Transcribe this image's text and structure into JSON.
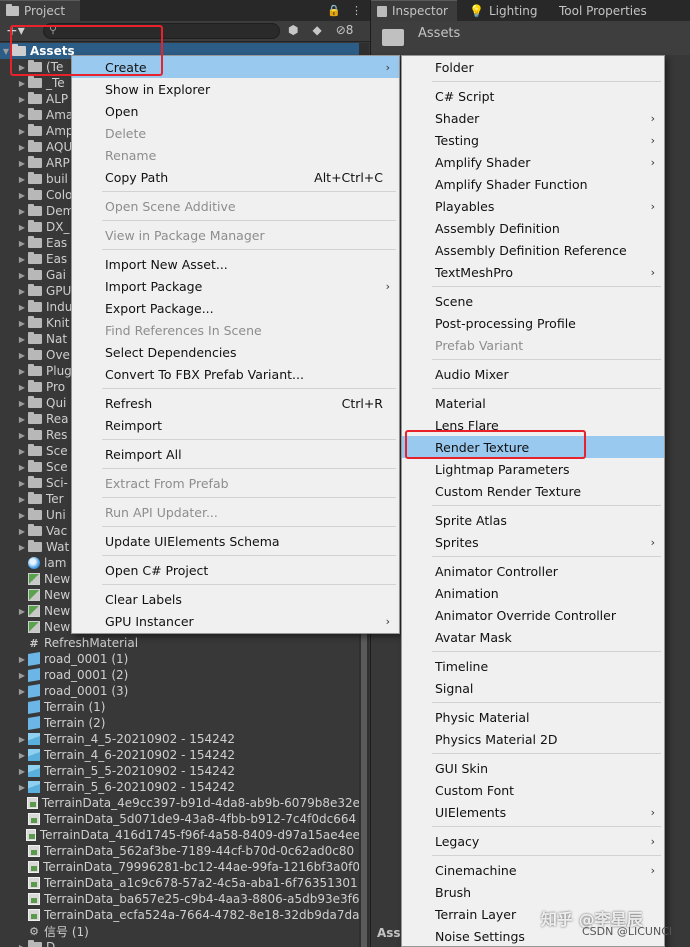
{
  "project_panel": {
    "tab_label": "Project",
    "hidden_count": "8",
    "assets_label": "Assets",
    "items": [
      {
        "label": "(Te",
        "type": "folder"
      },
      {
        "label": "_Te",
        "type": "folder"
      },
      {
        "label": "ALP",
        "type": "folder"
      },
      {
        "label": "Ama",
        "type": "folder"
      },
      {
        "label": "Amp",
        "type": "folder"
      },
      {
        "label": "AQU",
        "type": "folder"
      },
      {
        "label": "ARP",
        "type": "folder"
      },
      {
        "label": "buil",
        "type": "folder"
      },
      {
        "label": "Colo",
        "type": "folder"
      },
      {
        "label": "Dem",
        "type": "folder"
      },
      {
        "label": "DX_",
        "type": "folder"
      },
      {
        "label": "Eas",
        "type": "folder"
      },
      {
        "label": "Eas",
        "type": "folder"
      },
      {
        "label": "Gai",
        "type": "folder"
      },
      {
        "label": "GPU",
        "type": "folder"
      },
      {
        "label": "Indu",
        "type": "folder"
      },
      {
        "label": "Knit",
        "type": "folder"
      },
      {
        "label": "Nat",
        "type": "folder"
      },
      {
        "label": "Ove",
        "type": "folder"
      },
      {
        "label": "Plug",
        "type": "folder"
      },
      {
        "label": "Pro",
        "type": "folder"
      },
      {
        "label": "Qui",
        "type": "folder"
      },
      {
        "label": "Rea",
        "type": "folder"
      },
      {
        "label": "Res",
        "type": "folder"
      },
      {
        "label": "Sce",
        "type": "folder"
      },
      {
        "label": "Sce",
        "type": "folder"
      },
      {
        "label": "Sci-",
        "type": "folder"
      },
      {
        "label": "Ter",
        "type": "folder"
      },
      {
        "label": "Uni",
        "type": "folder"
      },
      {
        "label": "Vac",
        "type": "folder"
      },
      {
        "label": "Wat",
        "type": "folder"
      },
      {
        "label": "lam",
        "type": "sphere"
      },
      {
        "label": "New",
        "type": "rt"
      },
      {
        "label": "New",
        "type": "rt"
      },
      {
        "label": "New",
        "type": "rt",
        "arrow": true
      },
      {
        "label": "New",
        "type": "rt"
      },
      {
        "label": "RefreshMaterial",
        "type": "cs"
      },
      {
        "label": "road_0001 (1)",
        "type": "cube",
        "arrow": true
      },
      {
        "label": "road_0001 (2)",
        "type": "cube",
        "arrow": true
      },
      {
        "label": "road_0001 (3)",
        "type": "cube",
        "arrow": true
      },
      {
        "label": "Terrain (1)",
        "type": "cube"
      },
      {
        "label": "Terrain (2)",
        "type": "cube"
      },
      {
        "label": "Terrain_4_5-20210902 - 154242",
        "type": "terrain",
        "arrow": true
      },
      {
        "label": "Terrain_4_6-20210902 - 154242",
        "type": "terrain",
        "arrow": true
      },
      {
        "label": "Terrain_5_5-20210902 - 154242",
        "type": "terrain",
        "arrow": true
      },
      {
        "label": "Terrain_5_6-20210902 - 154242",
        "type": "terrain",
        "arrow": true
      },
      {
        "label": "TerrainData_4e9cc397-b91d-4da8-ab9b-6079b8e32e",
        "type": "tdata"
      },
      {
        "label": "TerrainData_5d071de9-43a8-4fbb-b912-7c4f0dc664",
        "type": "tdata"
      },
      {
        "label": "TerrainData_416d1745-f96f-4a58-8409-d97a15ae4ee",
        "type": "tdata"
      },
      {
        "label": "TerrainData_562af3be-7189-44cf-b70d-0c62ad0c80",
        "type": "tdata"
      },
      {
        "label": "TerrainData_79996281-bc12-44ae-99fa-1216bf3a0f0",
        "type": "tdata"
      },
      {
        "label": "TerrainData_a1c9c678-57a2-4c5a-aba1-6f76351301",
        "type": "tdata"
      },
      {
        "label": "TerrainData_ba657e25-c9b4-4aa3-8806-a5db93e3f6",
        "type": "tdata"
      },
      {
        "label": "TerrainData_ecfa524a-7664-4782-8e18-32db9da7da",
        "type": "tdata"
      },
      {
        "label": "信号 (1)",
        "type": "cfg"
      },
      {
        "label": "D...",
        "type": "folder"
      }
    ]
  },
  "inspector": {
    "tabs": [
      "Inspector",
      "Lighting",
      "Tool Properties"
    ],
    "header_title": "Assets",
    "bottom_label": "Ass"
  },
  "context_menu": {
    "items": [
      {
        "label": "Create",
        "submenu": true,
        "highlight": true
      },
      {
        "label": "Show in Explorer"
      },
      {
        "label": "Open"
      },
      {
        "label": "Delete",
        "disabled": true
      },
      {
        "label": "Rename",
        "disabled": true
      },
      {
        "label": "Copy Path",
        "shortcut": "Alt+Ctrl+C"
      },
      {
        "sep": true
      },
      {
        "label": "Open Scene Additive",
        "disabled": true
      },
      {
        "sep": true
      },
      {
        "label": "View in Package Manager",
        "disabled": true
      },
      {
        "sep": true
      },
      {
        "label": "Import New Asset..."
      },
      {
        "label": "Import Package",
        "submenu": true
      },
      {
        "label": "Export Package..."
      },
      {
        "label": "Find References In Scene",
        "disabled": true
      },
      {
        "label": "Select Dependencies"
      },
      {
        "label": "Convert To FBX Prefab Variant..."
      },
      {
        "sep": true
      },
      {
        "label": "Refresh",
        "shortcut": "Ctrl+R"
      },
      {
        "label": "Reimport"
      },
      {
        "sep": true
      },
      {
        "label": "Reimport All"
      },
      {
        "sep": true
      },
      {
        "label": "Extract From Prefab",
        "disabled": true
      },
      {
        "sep": true
      },
      {
        "label": "Run API Updater...",
        "disabled": true
      },
      {
        "sep": true
      },
      {
        "label": "Update UIElements Schema"
      },
      {
        "sep": true
      },
      {
        "label": "Open C# Project"
      },
      {
        "sep": true
      },
      {
        "label": "Clear Labels"
      },
      {
        "label": "GPU Instancer",
        "submenu": true
      }
    ]
  },
  "create_submenu": {
    "items": [
      {
        "label": "Folder"
      },
      {
        "sep": true
      },
      {
        "label": "C# Script"
      },
      {
        "label": "Shader",
        "submenu": true
      },
      {
        "label": "Testing",
        "submenu": true
      },
      {
        "label": "Amplify Shader",
        "submenu": true
      },
      {
        "label": "Amplify Shader Function"
      },
      {
        "label": "Playables",
        "submenu": true
      },
      {
        "label": "Assembly Definition"
      },
      {
        "label": "Assembly Definition Reference"
      },
      {
        "label": "TextMeshPro",
        "submenu": true
      },
      {
        "sep": true
      },
      {
        "label": "Scene"
      },
      {
        "label": "Post-processing Profile"
      },
      {
        "label": "Prefab Variant",
        "disabled": true
      },
      {
        "sep": true
      },
      {
        "label": "Audio Mixer"
      },
      {
        "sep": true
      },
      {
        "label": "Material"
      },
      {
        "label": "Lens Flare"
      },
      {
        "label": "Render Texture",
        "highlight": true
      },
      {
        "label": "Lightmap Parameters"
      },
      {
        "label": "Custom Render Texture"
      },
      {
        "sep": true
      },
      {
        "label": "Sprite Atlas"
      },
      {
        "label": "Sprites",
        "submenu": true
      },
      {
        "sep": true
      },
      {
        "label": "Animator Controller"
      },
      {
        "label": "Animation"
      },
      {
        "label": "Animator Override Controller"
      },
      {
        "label": "Avatar Mask"
      },
      {
        "sep": true
      },
      {
        "label": "Timeline"
      },
      {
        "label": "Signal"
      },
      {
        "sep": true
      },
      {
        "label": "Physic Material"
      },
      {
        "label": "Physics Material 2D"
      },
      {
        "sep": true
      },
      {
        "label": "GUI Skin"
      },
      {
        "label": "Custom Font"
      },
      {
        "label": "UIElements",
        "submenu": true
      },
      {
        "sep": true
      },
      {
        "label": "Legacy",
        "submenu": true
      },
      {
        "sep": true
      },
      {
        "label": "Cinemachine",
        "submenu": true
      },
      {
        "label": "Brush"
      },
      {
        "label": "Terrain Layer"
      },
      {
        "label": "Noise Settings"
      }
    ]
  },
  "watermark": {
    "zhihu": "知乎 @李星辰",
    "csdn": "CSDN @LICUNCI"
  },
  "colors": {
    "highlight": "#99c9ef",
    "annotation": "#e8222b",
    "selection": "#2c5d87"
  }
}
